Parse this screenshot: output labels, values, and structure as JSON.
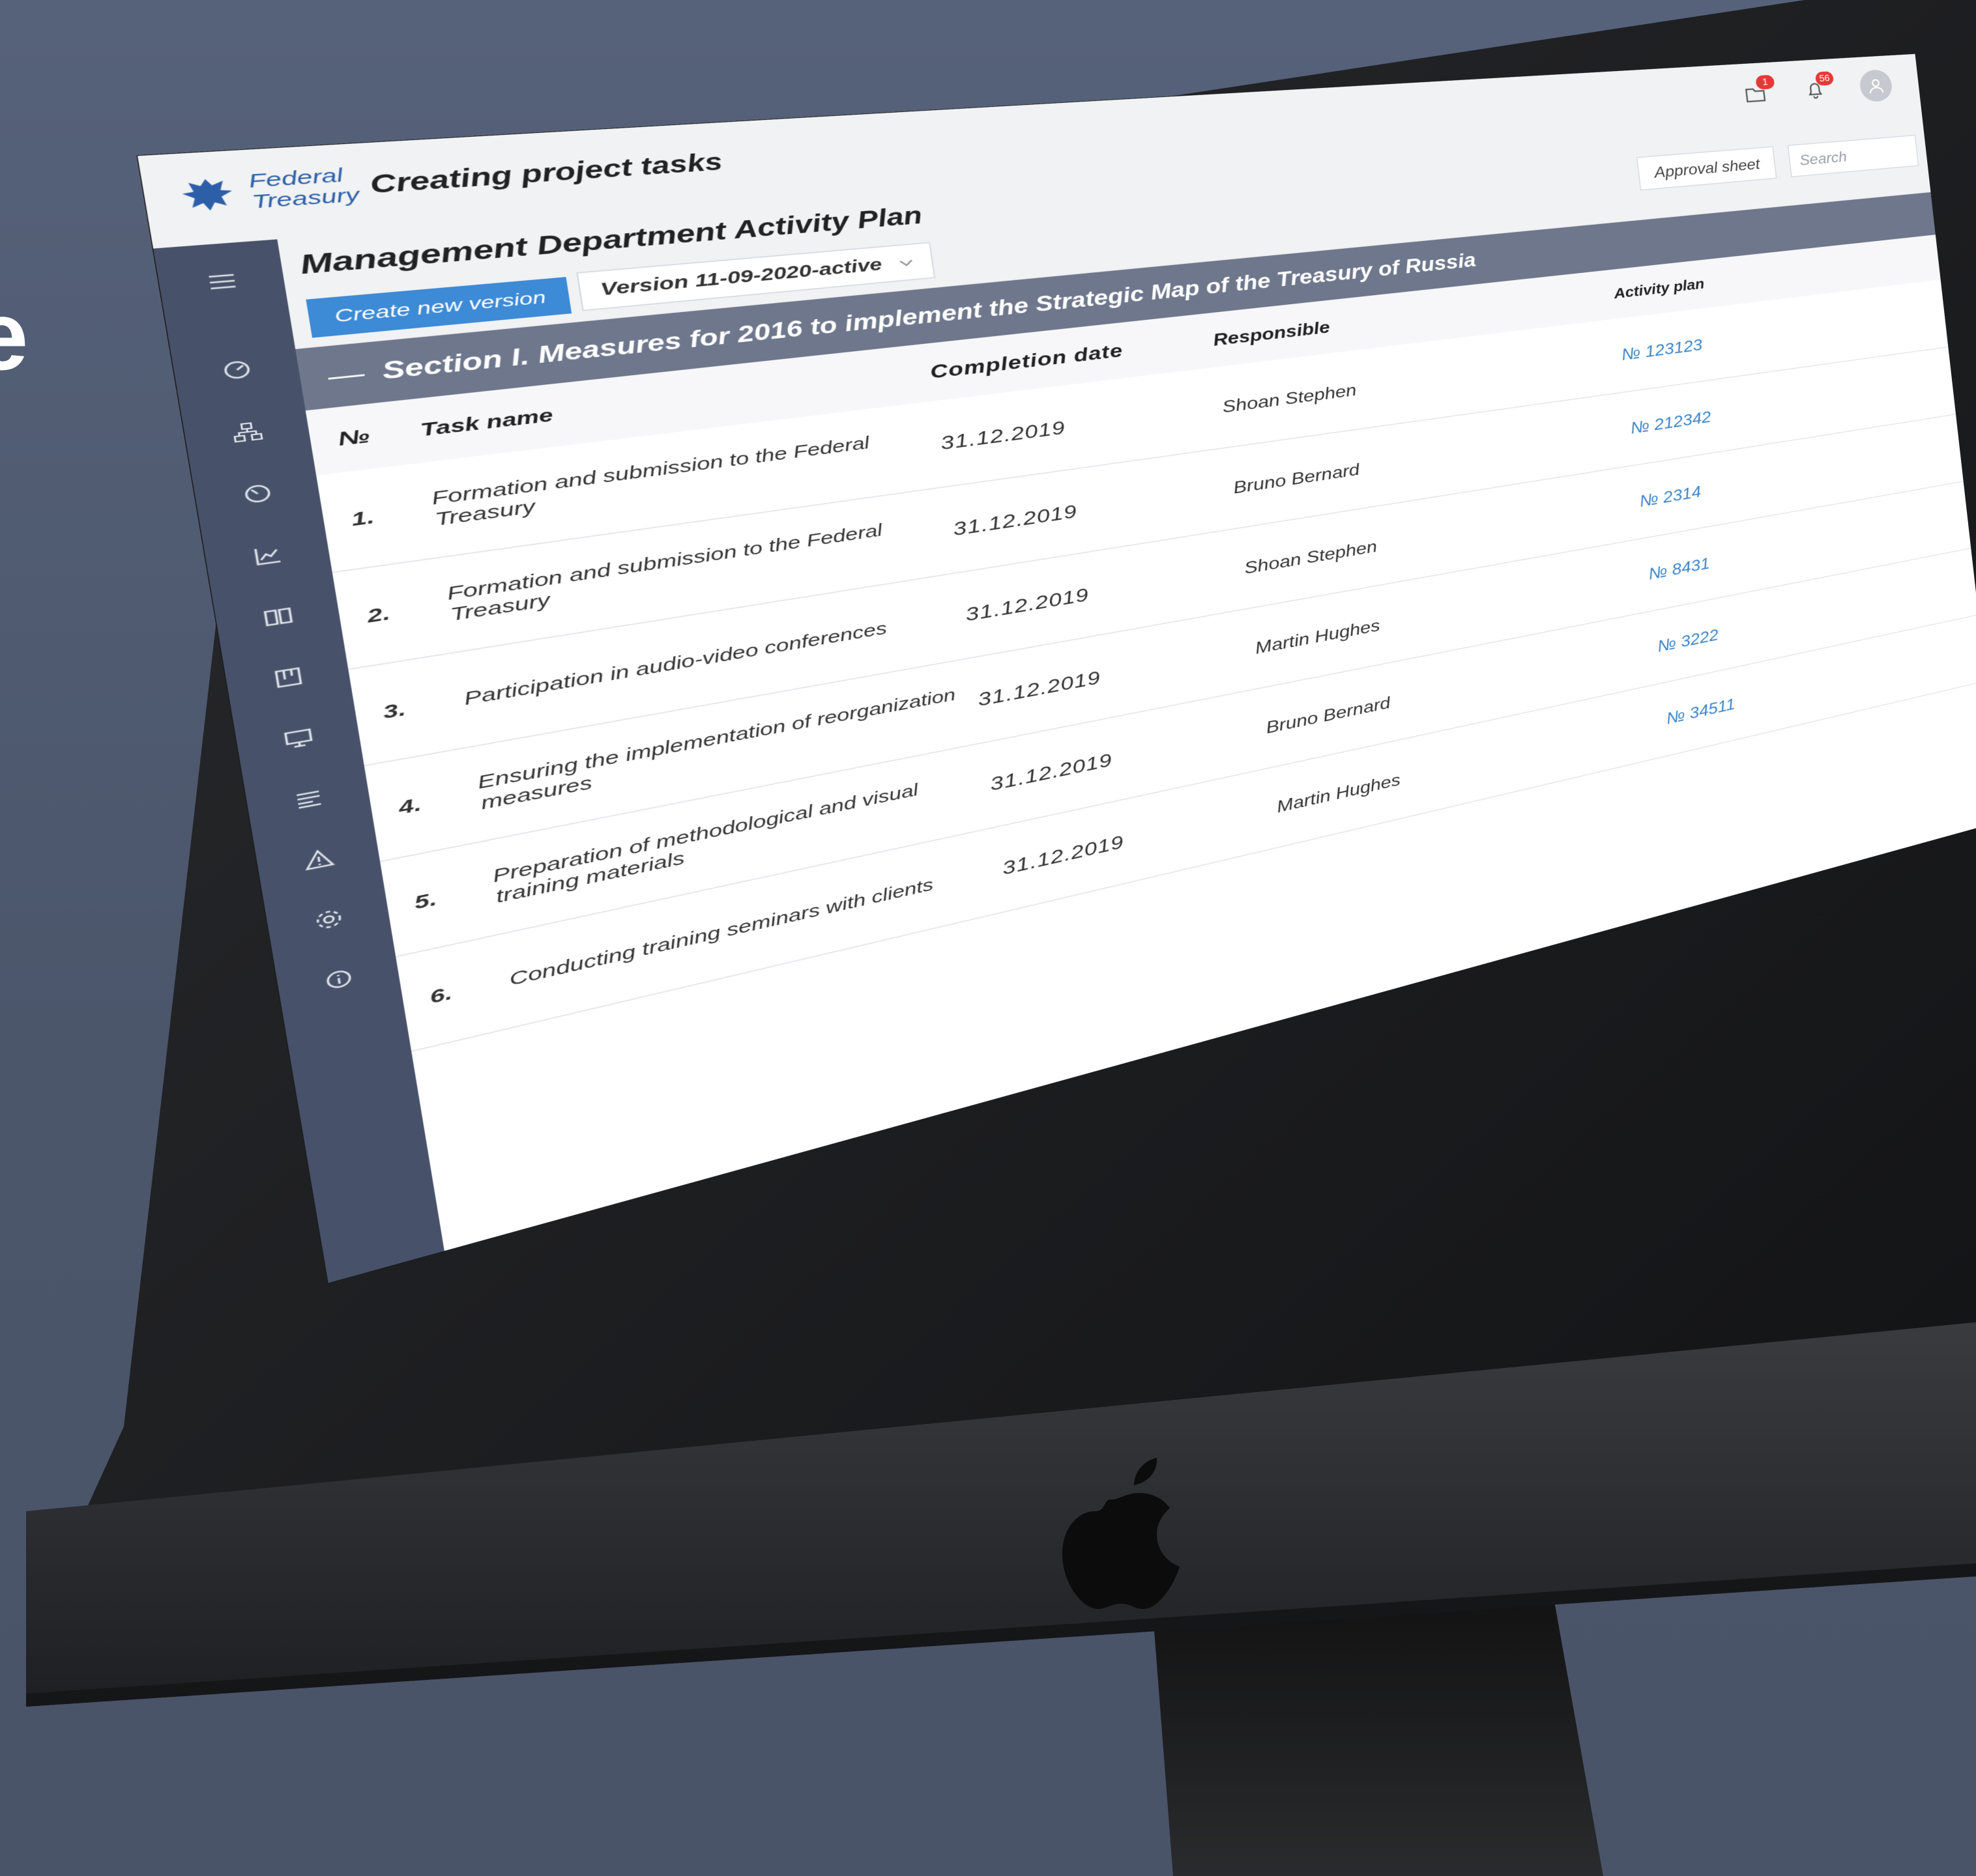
{
  "background": {
    "heading_fragment": "e"
  },
  "app": {
    "logo_line1": "Federal",
    "logo_line2": "Treasury",
    "title": "Creating project tasks",
    "folder_badge": "1",
    "bell_badge": "56"
  },
  "page": {
    "title": "Management Department Activity Plan",
    "create_button": "Create new version",
    "version_selected": "Version 11-09-2020-active",
    "approval_button": "Approval sheet",
    "search_placeholder": "Search"
  },
  "section": {
    "collapse_symbol": "—",
    "title": "Section I. Measures for 2016 to implement the Strategic Map of the Treasury of Russia"
  },
  "table": {
    "headers": {
      "num": "№",
      "name": "Task name",
      "date": "Completion date",
      "responsible": "Responsible",
      "plan": "Activity plan"
    },
    "rows": [
      {
        "num": "1.",
        "name": "Formation and submission to the Federal Treasury",
        "date": "31.12.2019",
        "responsible": "Shoan Stephen",
        "plan": "№ 123123"
      },
      {
        "num": "2.",
        "name": "Formation and submission to the Federal Treasury",
        "date": "31.12.2019",
        "responsible": "Bruno Bernard",
        "plan": "№ 212342"
      },
      {
        "num": "3.",
        "name": "Participation in audio-video conferences",
        "date": "31.12.2019",
        "responsible": "Shoan Stephen",
        "plan": "№ 2314"
      },
      {
        "num": "4.",
        "name": "Ensuring the implementation of reorganization measures",
        "date": "31.12.2019",
        "responsible": "Martin Hughes",
        "plan": "№ 8431"
      },
      {
        "num": "5.",
        "name": "Preparation of methodological and visual training materials",
        "date": "31.12.2019",
        "responsible": "Bruno Bernard",
        "plan": "№ 3222"
      },
      {
        "num": "6.",
        "name": "Conducting training seminars with clients",
        "date": "31.12.2019",
        "responsible": "Martin Hughes",
        "plan": "№ 34511"
      }
    ]
  },
  "sidebar_icons": [
    "menu-icon",
    "dashboard-icon",
    "org-structure-icon",
    "speedometer-icon",
    "chart-icon",
    "book-icon",
    "kanban-icon",
    "monitor-icon",
    "list-icon",
    "warning-icon",
    "settings-icon",
    "info-icon"
  ],
  "colors": {
    "sidebar": "#47526a",
    "section_bar": "#6e778b",
    "accent_blue": "#3d8ad6",
    "link_blue": "#3d86c8",
    "badge_red": "#e53935"
  }
}
